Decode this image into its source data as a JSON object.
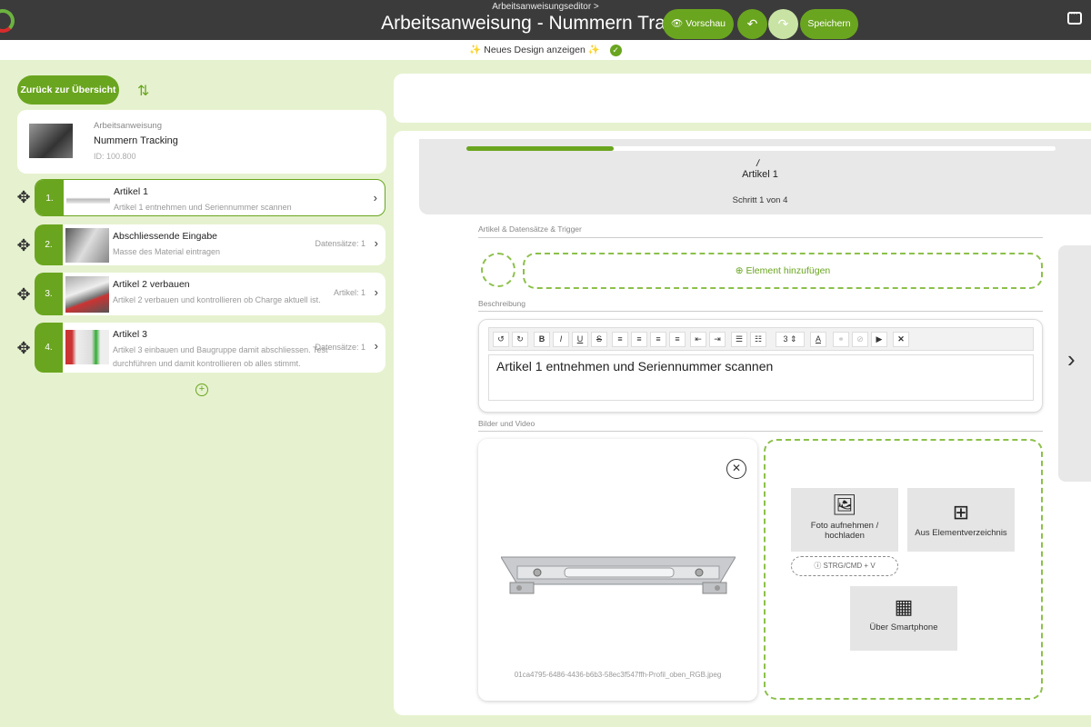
{
  "header": {
    "breadcrumb": "Arbeitsanweisungseditor >",
    "title": "Arbeitsanweisung - Nummern Tracking"
  },
  "banner": {
    "label": "✨ Neues Design anzeigen ✨",
    "check": "✓"
  },
  "left": {
    "back_button": "Zurück zur Übersicht",
    "info": {
      "label": "Arbeitsanweisung",
      "name": "Nummern Tracking",
      "id": "ID: 100.800"
    },
    "steps": [
      {
        "num": "1.",
        "title": "Artikel 1",
        "desc": "Artikel 1 entnehmen und Seriennummer scannen",
        "data": ""
      },
      {
        "num": "2.",
        "title": "Abschliessende Eingabe",
        "desc": "Masse des Material eintragen",
        "data": "Datensätze: 1"
      },
      {
        "num": "3.",
        "title": "Artikel 2 verbauen",
        "desc": "Artikel 2 verbauen und kontrollieren ob Charge aktuell ist.",
        "data": "Artikel: 1"
      },
      {
        "num": "4.",
        "title": "Artikel 3",
        "desc": "Artikel 3 einbauen und Baugruppe damit abschliessen. Test durchführen und damit kontrollieren ob alles stimmt.",
        "data": "Datensätze: 1"
      }
    ]
  },
  "toolbar": {
    "preview": "Vorschau",
    "undo": "↶",
    "redo": "↷",
    "save": "Speichern"
  },
  "editor": {
    "progress_fraction": 0.25,
    "step_name": "Artikel 1",
    "step_count": "Schritt 1 von 4",
    "sections": {
      "items": "Artikel & Datensätze & Trigger",
      "description": "Beschreibung",
      "media": "Bilder und Video"
    },
    "add_element": "Element hinzufügen",
    "description_text": "Artikel 1 entnehmen und Seriennummer scannen",
    "font_size": "3",
    "media_filename": "01ca4795-6486-4436-b6b3-58ec3f547ffh-Profil_oben_RGB.jpeg",
    "upload": {
      "photo": "Foto aufnehmen / hochladen",
      "catalog": "Aus Elementverzeichnis",
      "shortcut": "STRG/CMD + V",
      "smartphone": "Über Smartphone"
    }
  },
  "colors": {
    "accent": "#6aa51f",
    "accent_light": "#e6f2cf",
    "header": "#3b3b3b"
  }
}
